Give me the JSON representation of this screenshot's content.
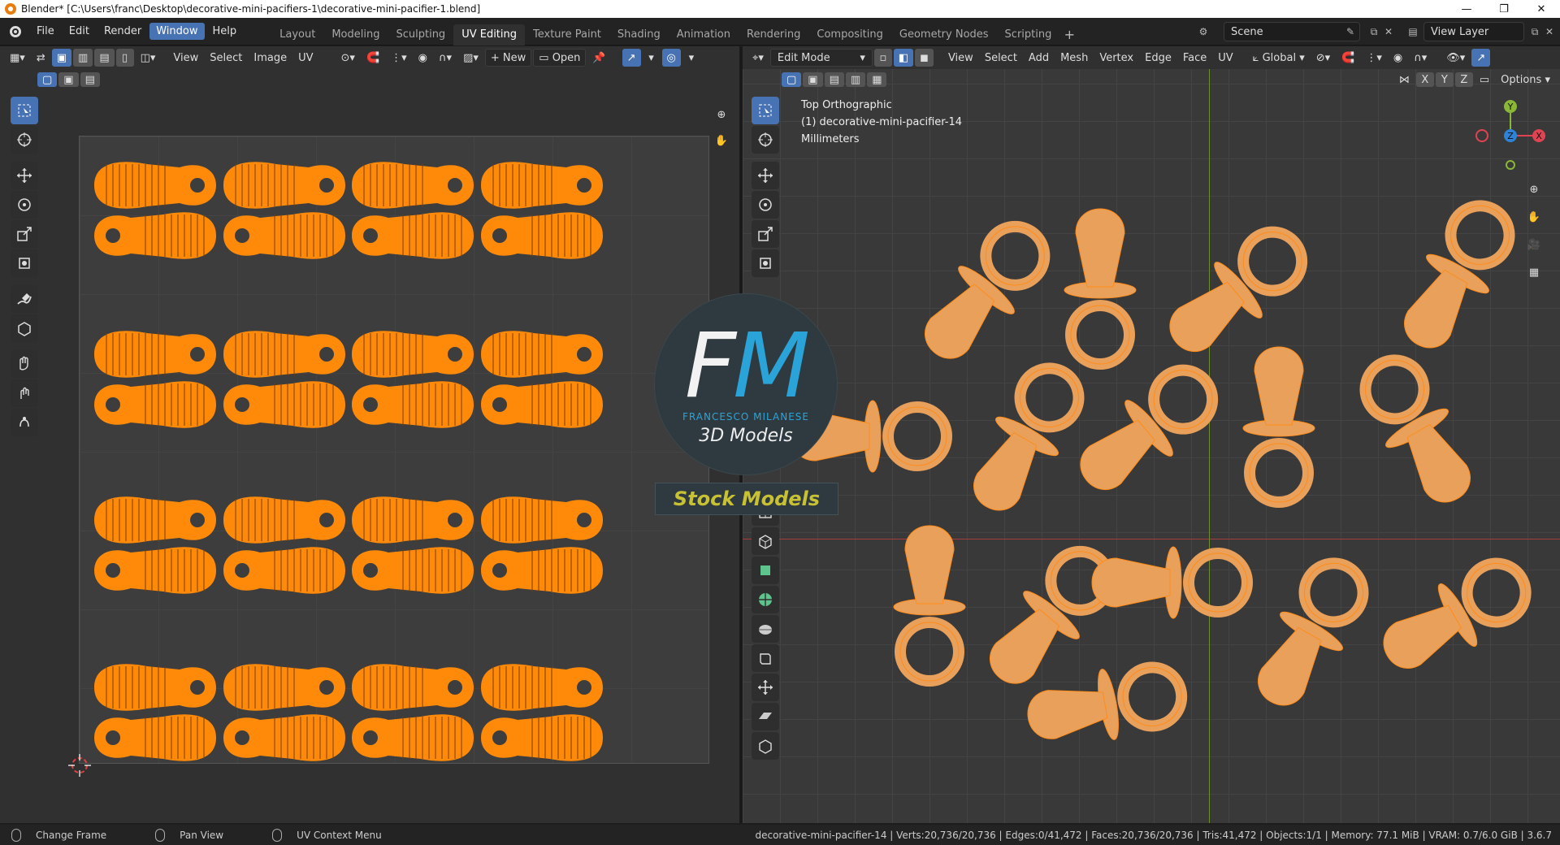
{
  "window": {
    "title": "Blender* [C:\\Users\\franc\\Desktop\\decorative-mini-pacifiers-1\\decorative-mini-pacifier-1.blend]",
    "minimize": "—",
    "maximize": "❐",
    "close": "✕"
  },
  "menus": [
    "File",
    "Edit",
    "Render",
    "Window",
    "Help"
  ],
  "workspaces": [
    "Layout",
    "Modeling",
    "Sculpting",
    "UV Editing",
    "Texture Paint",
    "Shading",
    "Animation",
    "Rendering",
    "Compositing",
    "Geometry Nodes",
    "Scripting"
  ],
  "scene": {
    "label": "Scene",
    "view_layer": "View Layer"
  },
  "uv_editor": {
    "menus": [
      "View",
      "Select",
      "Image",
      "UV"
    ],
    "new_label": "New",
    "open_label": "Open"
  },
  "viewport": {
    "mode": "Edit Mode",
    "menus": [
      "View",
      "Select",
      "Add",
      "Mesh",
      "Vertex",
      "Edge",
      "Face",
      "UV"
    ],
    "orientation": "Global",
    "options_label": "Options",
    "axes": [
      "X",
      "Y",
      "Z"
    ],
    "info_line1": "Top Orthographic",
    "info_line2": "(1) decorative-mini-pacifier-14",
    "info_line3": "Millimeters"
  },
  "watermark": {
    "fm_f": "F",
    "fm_m": "M",
    "name": "FRANCESCO MILANESE",
    "sub": "3D Models",
    "stock": "Stock Models"
  },
  "status": {
    "change_frame": "Change Frame",
    "pan_view": "Pan View",
    "uv_context_menu": "UV Context Menu",
    "stats": "decorative-mini-pacifier-14 | Verts:20,736/20,736 | Edges:0/41,472 | Faces:20,736/20,736 | Tris:41,472 | Objects:1/1 | Memory: 77.1 MiB | VRAM: 0.7/6.0 GiB | 3.6.7"
  },
  "colors": {
    "accent": "#4772b3",
    "uv_orange": "#ff8a0a",
    "mesh_orange": "#e8a05a",
    "brand_blue": "#2aa4d8"
  }
}
